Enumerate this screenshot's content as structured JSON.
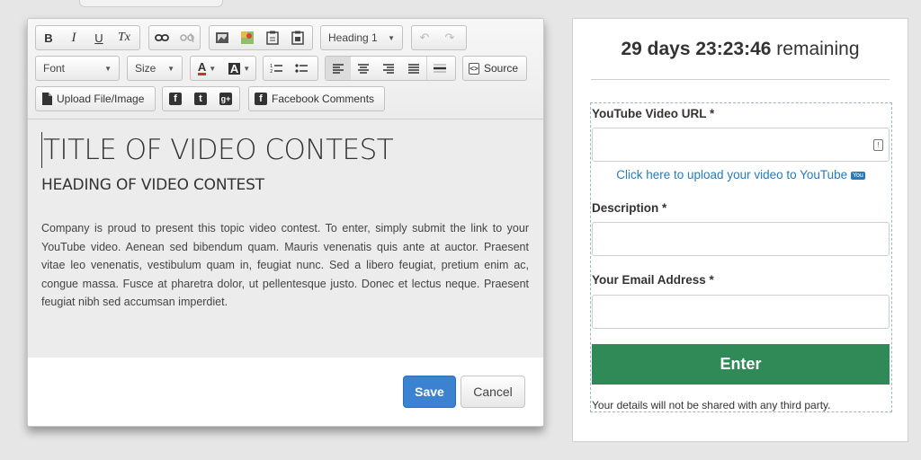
{
  "toolbar": {
    "bold": "B",
    "italic": "I",
    "underline": "U",
    "clear_format": "Tx",
    "format_select": "Heading 1",
    "font_select": "Font",
    "size_select": "Size",
    "text_color": "A",
    "bg_color": "A",
    "source_label": "Source",
    "upload_label": "Upload File/Image",
    "facebook_comments_label": "Facebook Comments",
    "icons": [
      "link-icon",
      "unlink-icon",
      "image-icon",
      "map-icon",
      "paste-icon",
      "paste-text-icon",
      "undo-icon",
      "redo-icon",
      "numbered-list-icon",
      "bulleted-list-icon",
      "align-left-icon",
      "align-center-icon",
      "align-right-icon",
      "justify-icon",
      "horizontal-rule-icon",
      "source-icon",
      "file-icon",
      "facebook-icon",
      "twitter-icon",
      "google-plus-icon"
    ]
  },
  "editor": {
    "title": "TITLE OF VIDEO CONTEST",
    "heading": "HEADING OF VIDEO CONTEST",
    "body": "Company is proud to present this topic video contest. To enter, simply submit the link to your YouTube video. Aenean sed bibendum quam. Mauris venenatis quis ante at auctor. Praesent vitae leo venenatis, vestibulum quam in, feugiat nunc. Sed a libero feugiat, pretium enim ac, congue massa. Fusce at pharetra dolor, ut pellentesque justo. Donec et lectus neque. Praesent feugiat nibh sed accumsan imperdiet."
  },
  "actions": {
    "save_label": "Save",
    "cancel_label": "Cancel",
    "save_color": "#3b83d1"
  },
  "form": {
    "countdown_value": "29 days 23:23:46",
    "countdown_suffix": "remaining",
    "url_label": "YouTube Video URL *",
    "url_value": "",
    "upload_link": "Click here to upload your video to YouTube",
    "youtube_badge": "You",
    "description_label": "Description *",
    "description_value": "",
    "email_label": "Your Email Address *",
    "email_value": "",
    "enter_label": "Enter",
    "enter_color": "#2f8a57",
    "disclaimer": "Your details will not be shared with any third party."
  }
}
